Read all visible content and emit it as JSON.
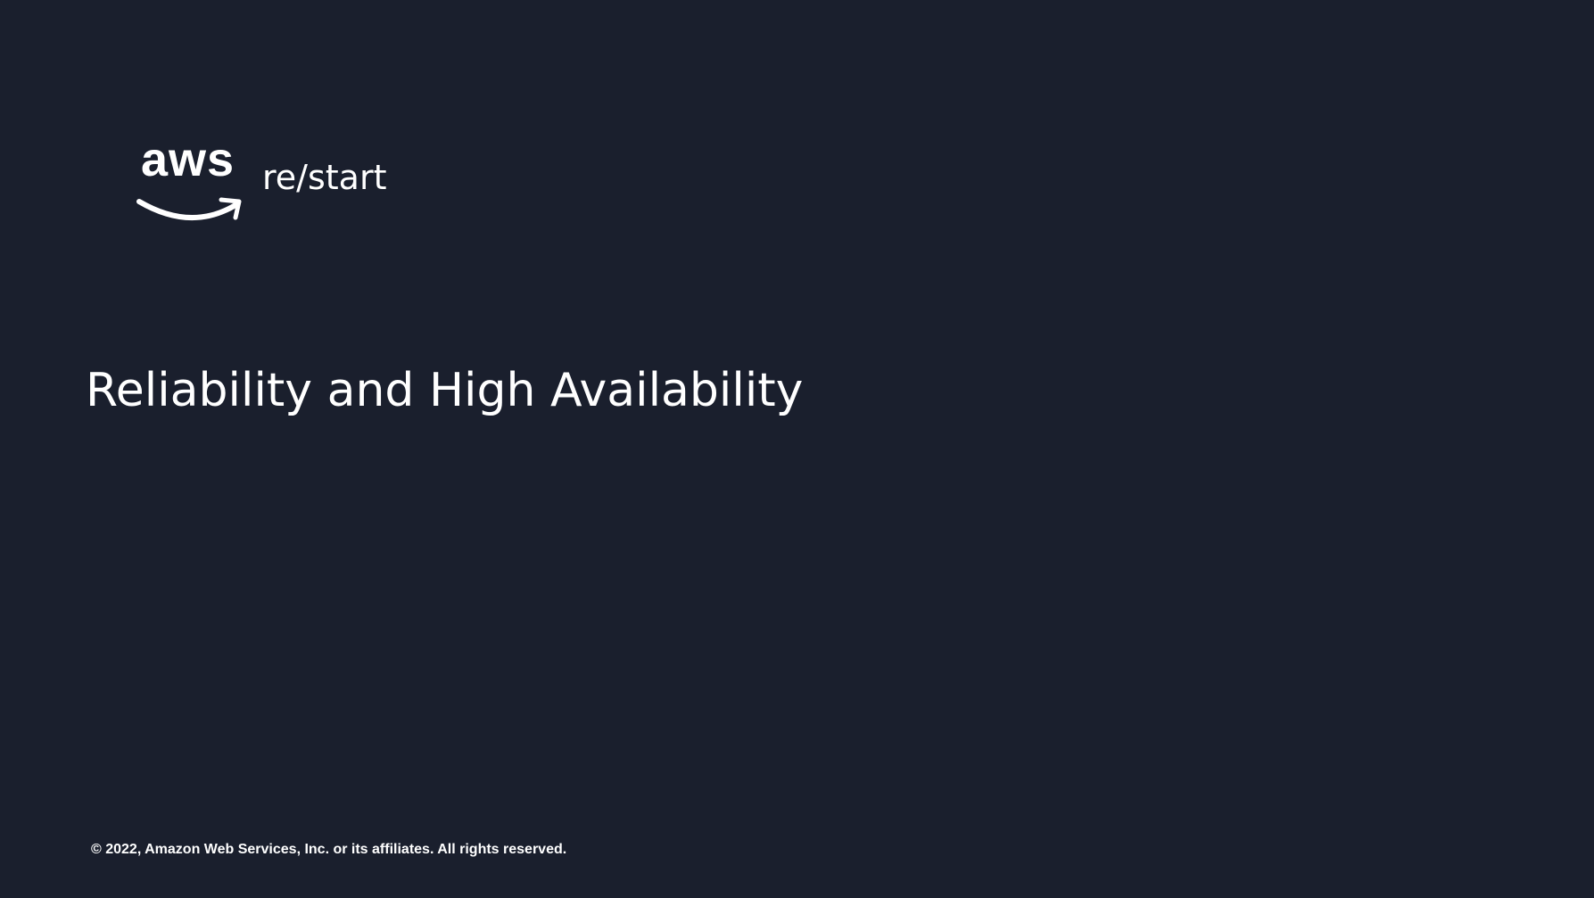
{
  "logo": {
    "brand": "aws",
    "product": "re/start",
    "smile_color": "#ffffff"
  },
  "slide": {
    "title": "Reliability and High Availability",
    "background_color": "#1a1f2d"
  },
  "footer": {
    "copyright": "© 2022, Amazon Web Services, Inc. or its affiliates. All rights reserved."
  }
}
